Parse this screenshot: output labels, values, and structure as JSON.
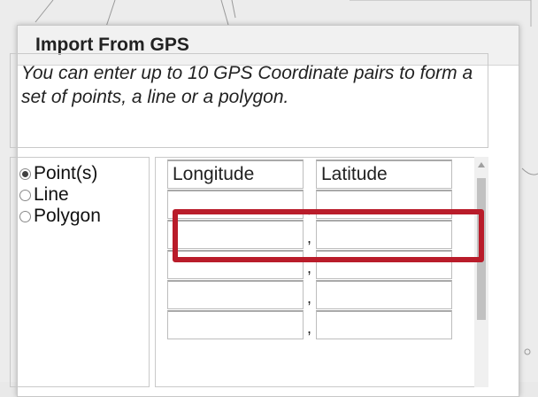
{
  "dialog": {
    "title": "Import From GPS",
    "instructions": "You can enter up to 10 GPS Coordinate pairs to form a set of points, a line or a polygon."
  },
  "modes": [
    {
      "label": "Point(s)",
      "checked": true
    },
    {
      "label": "Line",
      "checked": false
    },
    {
      "label": "Polygon",
      "checked": false
    }
  ],
  "coordinates": {
    "longitude_header": "Longitude",
    "latitude_header": "Latitude",
    "separator": ",",
    "rows": [
      {
        "longitude": "",
        "latitude": ""
      },
      {
        "longitude": "",
        "latitude": ""
      },
      {
        "longitude": "",
        "latitude": ""
      },
      {
        "longitude": "",
        "latitude": ""
      },
      {
        "longitude": "",
        "latitude": ""
      }
    ]
  },
  "colors": {
    "highlight": "#b91c2a",
    "titlebar": "#f1f1f1"
  }
}
